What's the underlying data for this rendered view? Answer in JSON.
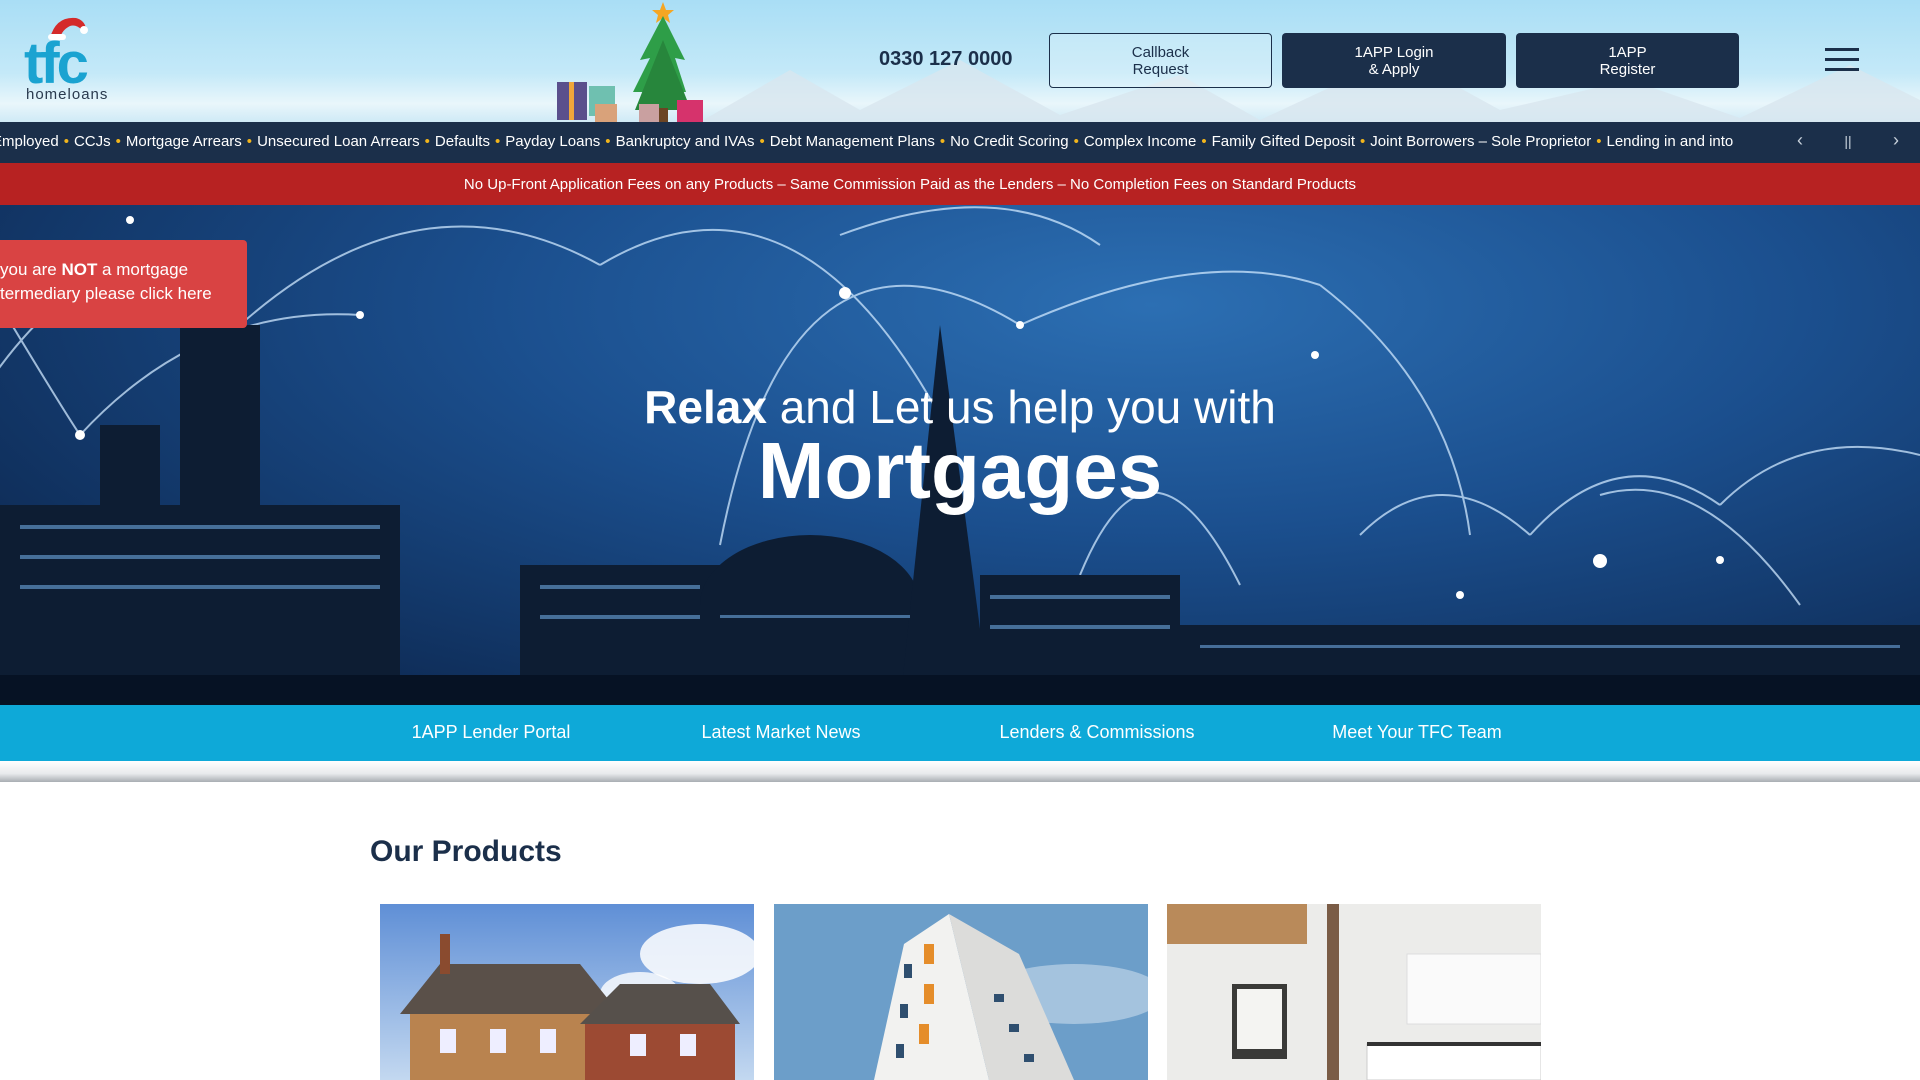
{
  "header": {
    "logo_text": "tfc",
    "logo_subtext": "homeloans",
    "phone": "0330 127 0000",
    "buttons": [
      {
        "label": "Callback\nRequest"
      },
      {
        "label": "1APP Login\n& Apply"
      },
      {
        "label": "1APP\nRegister"
      }
    ],
    "menu_icon": "hamburger-icon"
  },
  "ticker": {
    "items": [
      "Employed",
      "CCJs",
      "Mortgage Arrears",
      "Unsecured Loan Arrears",
      "Defaults",
      "Payday Loans",
      "Bankruptcy and IVAs",
      "Debt Management Plans",
      "No Credit Scoring",
      "Complex Income",
      "Family Gifted Deposit",
      "Joint Borrowers – Sole Proprietor",
      "Lending in and into"
    ],
    "controls": {
      "prev": "‹",
      "pause": "||",
      "next": "›"
    },
    "separator_color": "#f2b51c"
  },
  "announcement": "No Up-Front Application Fees on any Products – Same Commission Paid as the Lenders – No Completion Fees on Standard Products",
  "hero": {
    "notice": {
      "line1_pre": "you are ",
      "line1_bold": "NOT",
      "line1_post": " a mortgage",
      "line2": "termediary please click here"
    },
    "headline_bold": "Relax",
    "headline_rest": " and Let us help you with",
    "subheadline": "Mortgages"
  },
  "nav": {
    "items": [
      {
        "label": "1APP Lender Portal"
      },
      {
        "label": "Latest Market News"
      },
      {
        "label": "Lenders & Commissions"
      },
      {
        "label": "Meet Your TFC Team"
      }
    ]
  },
  "products": {
    "title": "Our Products",
    "cards": [
      {
        "image": "detached-house-photo"
      },
      {
        "image": "apartment-tower-photo"
      },
      {
        "image": "modern-kitchen-photo"
      }
    ]
  },
  "colors": {
    "navy": "#1b2f4a",
    "brand_blue": "#0ea9d8",
    "red": "#b72222",
    "notice_red": "#d94343"
  }
}
